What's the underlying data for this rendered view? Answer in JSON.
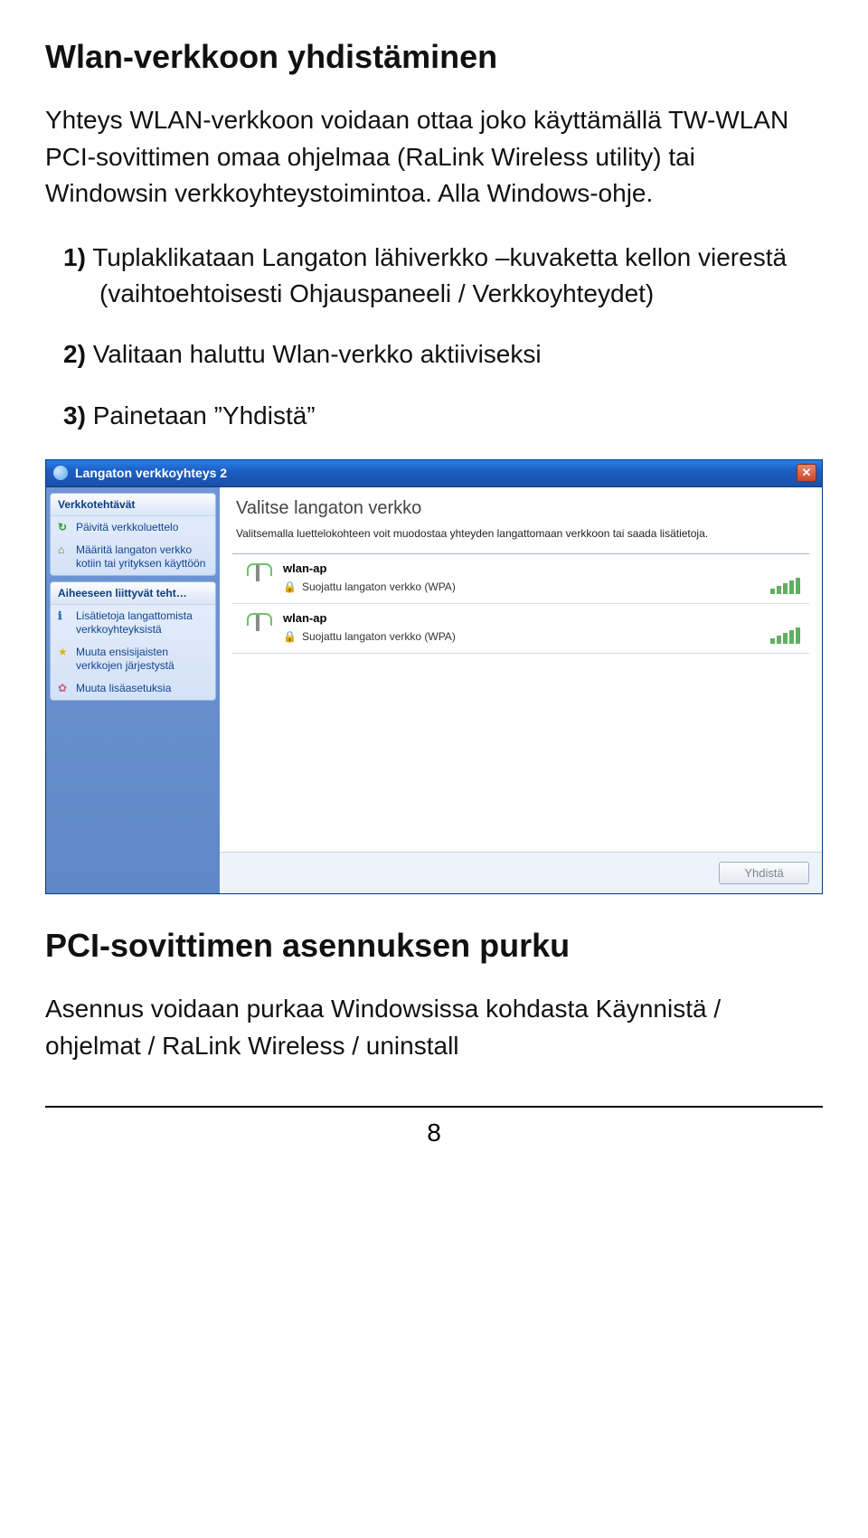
{
  "doc": {
    "heading1": "Wlan-verkkoon yhdistäminen",
    "intro": "Yhteys WLAN-verkkoon voidaan ottaa joko käyttämällä TW-WLAN PCI-sovittimen omaa ohjelmaa (RaLink Wireless utility) tai Windowsin verkkoyhteystoimintoa. Alla Windows-ohje.",
    "step1_num": "1)",
    "step1": "Tuplaklikataan Langaton lähiverkko –kuvaketta kellon vierestä (vaihtoehtoisesti Ohjauspaneeli / Verkkoyhteydet)",
    "step2_num": "2)",
    "step2": "Valitaan haluttu Wlan-verkko aktiiviseksi",
    "step3_num": "3)",
    "step3": "Painetaan ”Yhdistä”",
    "heading2": "PCI-sovittimen asennuksen purku",
    "uninstall": "Asennus voidaan purkaa Windowsissa kohdasta Käynnistä / ohjelmat / RaLink Wireless / uninstall",
    "page": "8"
  },
  "win": {
    "title": "Langaton verkkoyhteys 2",
    "sidebar": {
      "g1header": "Verkkotehtävät",
      "g1a": "Päivitä verkkoluettelo",
      "g1b": "Määritä langaton verkko kotiin tai yrityksen käyttöön",
      "g2header": "Aiheeseen liittyvät teht…",
      "g2a": "Lisätietoja langattomista verkkoyhteyksistä",
      "g2b": "Muuta ensisijaisten verkkojen järjestystä",
      "g2c": "Muuta lisäasetuksia"
    },
    "mainTitle": "Valitse langaton verkko",
    "mainDesc": "Valitsemalla luettelokohteen voit muodostaa yhteyden langattomaan verkkoon tai saada lisätietoja.",
    "networks": [
      {
        "name": "wlan-ap",
        "sec": "Suojattu langaton verkko (WPA)"
      },
      {
        "name": "wlan-ap",
        "sec": "Suojattu langaton verkko (WPA)"
      }
    ],
    "connect": "Yhdistä"
  }
}
